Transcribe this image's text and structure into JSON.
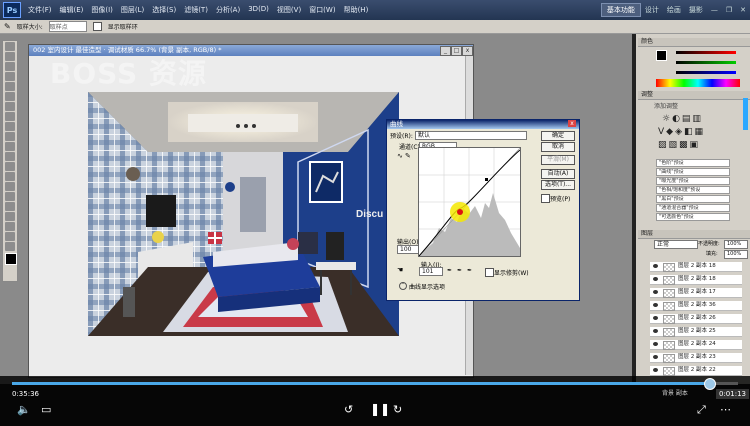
{
  "menubar": {
    "items": [
      "文件(F)",
      "编辑(E)",
      "图像(I)",
      "图层(L)",
      "选择(S)",
      "滤镜(T)",
      "分析(A)",
      "3D(D)",
      "视图(V)",
      "窗口(W)",
      "帮助(H)"
    ],
    "workspace_button": "基本功能",
    "window_labels": [
      "设计",
      "绘画",
      "摄影"
    ]
  },
  "options": {
    "sample_label": "取样大小:",
    "sample_value": "取样点",
    "show_ring_label": "显示取样环"
  },
  "document": {
    "title": "002 室内设计 最佳造型 · 调试材质 66.7% (背景 副本, RGB/8) *",
    "watermark": "BOSS 资源"
  },
  "scene": {
    "logo_text": "Discu"
  },
  "curves": {
    "title": "曲线",
    "preset_label": "预设(R):",
    "preset_value": "默认",
    "channel_label": "通道(C):",
    "channel_value": "RGB",
    "buttons": [
      "确定",
      "取消",
      "平滑(M)",
      "自动(A)",
      "选项(T)..."
    ],
    "preview_label": "预览(P)",
    "output_label": "输出(O):",
    "output_value": "100",
    "input_label": "输入(I):",
    "input_value": "101",
    "clipping_label": "显示修剪(W)",
    "display_options": "曲线显示选项"
  },
  "panels": {
    "color_tab": "颜色",
    "adjust_tab": "调整",
    "add_adjust": "添加调整",
    "presets": [
      "\"色阶\"预设",
      "\"曲线\"预设",
      "\"曝光度\"预设",
      "\"色相/饱和度\"预设",
      "\"黑白\"预设",
      "\"通道混合器\"预设",
      "\"可选颜色\"预设"
    ],
    "layers_tab": "图层",
    "blend_mode": "正常",
    "opacity_label": "不透明度:",
    "opacity_value": "100%",
    "fill_label": "填充:",
    "fill_value": "100%",
    "layers": [
      "图层 2 副本 18",
      "图层 2 副本 18",
      "图层 2 副本 17",
      "图层 2 副本 36",
      "图层 2 副本 26",
      "图层 2 副本 25",
      "图层 2 副本 24",
      "图层 2 副本 23",
      "图层 2 副本 22"
    ],
    "bg_layer": "背景 副本"
  },
  "player": {
    "progress_fraction": 0.96,
    "current_time": "0:35:36",
    "hover_time": "0:01:13"
  },
  "colors": {
    "accent": "#4aa8e8",
    "menubar": "#233552",
    "wall_blue": "#1d3f8a"
  }
}
